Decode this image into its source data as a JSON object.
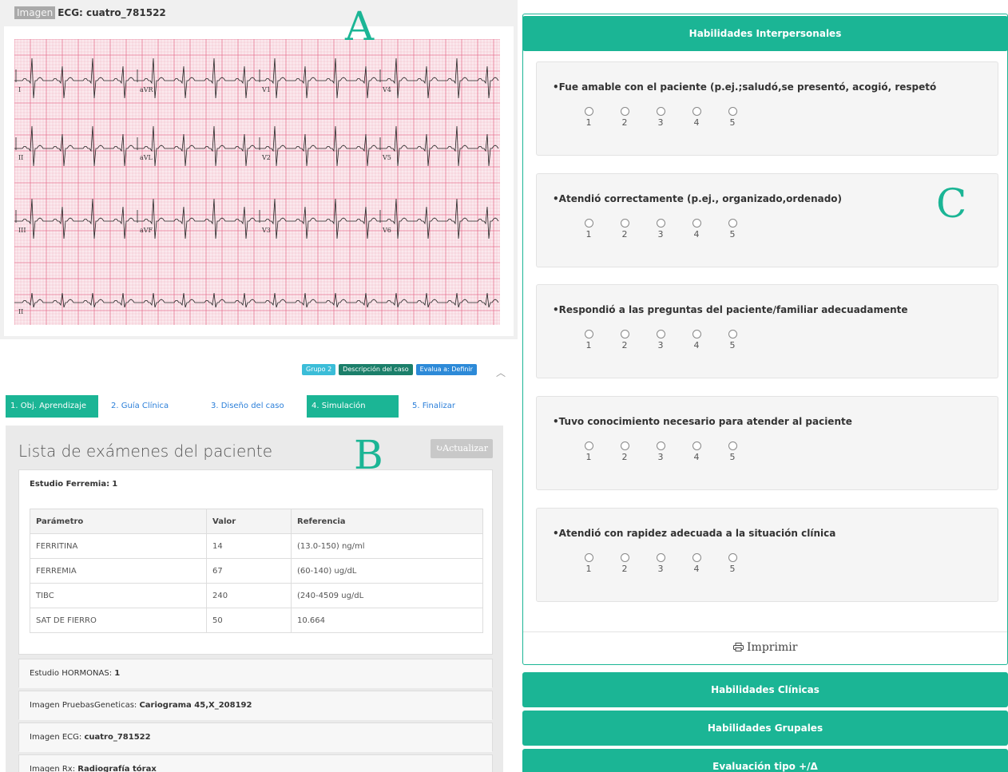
{
  "panel_a": {
    "tag": "Imagen",
    "title": "ECG: cuatro_781522",
    "letter": "A",
    "lead_labels": [
      "I",
      "aVR",
      "V1",
      "V4",
      "II",
      "aVL",
      "V2",
      "V5",
      "III",
      "aVF",
      "V3",
      "V6",
      "II"
    ]
  },
  "panel_b": {
    "letter": "B",
    "badges": [
      "Grupo 2",
      "Descripción del caso",
      "Evalua a: Definir"
    ],
    "chevron": "︿",
    "steps": [
      "1. Obj. Aprendizaje",
      "2. Guía Clínica",
      "3. Diseño del caso",
      "4. Simulación",
      "5. Finalizar"
    ],
    "list_title": "Lista de exámenes del paciente",
    "refresh_label": "↻Actualizar",
    "study1": {
      "prefix": "Estudio Ferremia:",
      "count": "1",
      "columns": [
        "Parámetro",
        "Valor",
        "Referencia"
      ],
      "rows": [
        [
          "FERRITINA",
          "14",
          "(13.0-150) ng/ml"
        ],
        [
          "FERREMIA",
          "67",
          "(60-140) ug/dL"
        ],
        [
          "TIBC",
          "240",
          "(240-4509 ug/dL"
        ],
        [
          "SAT DE FIERRO",
          "50",
          "10.664"
        ]
      ]
    },
    "study2": {
      "prefix": "Estudio HORMONAS:",
      "value": "1"
    },
    "study3": {
      "prefix": "Imagen PruebasGeneticas:",
      "value": "Cariograma 45,X_208192"
    },
    "study4": {
      "prefix": "Imagen ECG:",
      "value": "cuatro_781522"
    },
    "study5": {
      "prefix": "Imagen Rx:",
      "value": "Radiografía tórax"
    }
  },
  "panel_c": {
    "letter": "C",
    "header": "Habilidades Interpersonales",
    "questions": [
      "•Fue amable con el paciente (p.ej.;saludó,se presentó, acogió, respetó",
      "•Atendió correctamente (p.ej., organizado,ordenado)",
      "•Respondió a las preguntas del paciente/familiar adecuadamente",
      "•Tuvo conocimiento necesario para atender al paciente",
      "•Atendió con rapidez adecuada a la situación clínica"
    ],
    "scale": [
      "1",
      "2",
      "3",
      "4",
      "5"
    ],
    "print_label": "Imprimir",
    "print_icon": "print-icon",
    "sections": [
      "Habilidades Clínicas",
      "Habilidades Grupales",
      "Evaluación tipo +/Δ"
    ]
  },
  "colors": {
    "accent": "#1bb595",
    "link": "#2b7fd9",
    "ecg_grid": "#e46b8a"
  }
}
